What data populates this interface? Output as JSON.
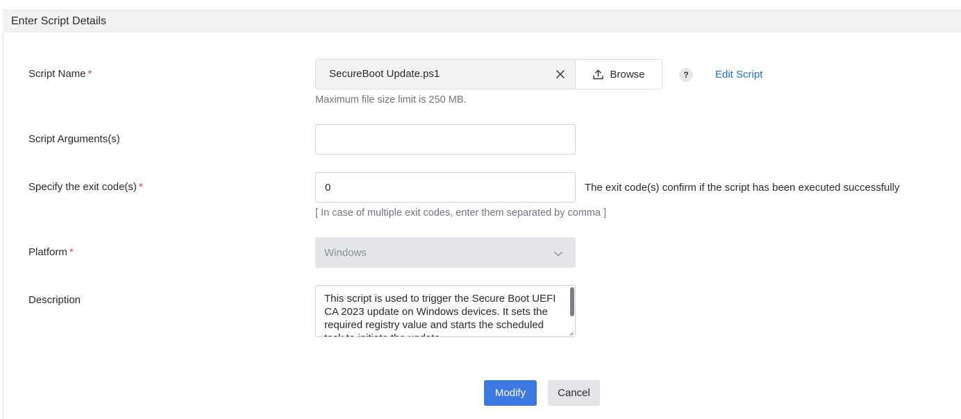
{
  "section": {
    "title": "Enter Script Details"
  },
  "fields": {
    "script_name": {
      "label": "Script Name",
      "required_mark": "*",
      "file_name": "SecureBoot Update.ps1",
      "clear_icon": "close-icon",
      "browse_label": "Browse",
      "browse_icon": "upload-icon",
      "help_label": "?",
      "edit_link": "Edit Script",
      "hint": "Maximum file size limit is 250 MB."
    },
    "script_arguments": {
      "label": "Script Arguments(s)",
      "value": ""
    },
    "exit_codes": {
      "label": "Specify the exit code(s)",
      "required_mark": "*",
      "value": "0",
      "note": "The exit code(s) confirm if the script has been executed successfully",
      "hint": "[ In case of multiple exit codes, enter them separated by comma ]"
    },
    "platform": {
      "label": "Platform",
      "required_mark": "*",
      "selected": "Windows",
      "icon": "chevron-down-icon"
    },
    "description": {
      "label": "Description",
      "value": "This script is used to trigger the Secure Boot UEFI CA 2023 update on Windows devices. It sets the required registry value and starts the scheduled task to initiate the update."
    }
  },
  "actions": {
    "modify_label": "Modify",
    "cancel_label": "Cancel"
  },
  "colors": {
    "accent": "#3c78e0",
    "link": "#1a73c8",
    "required": "#e5483b"
  }
}
